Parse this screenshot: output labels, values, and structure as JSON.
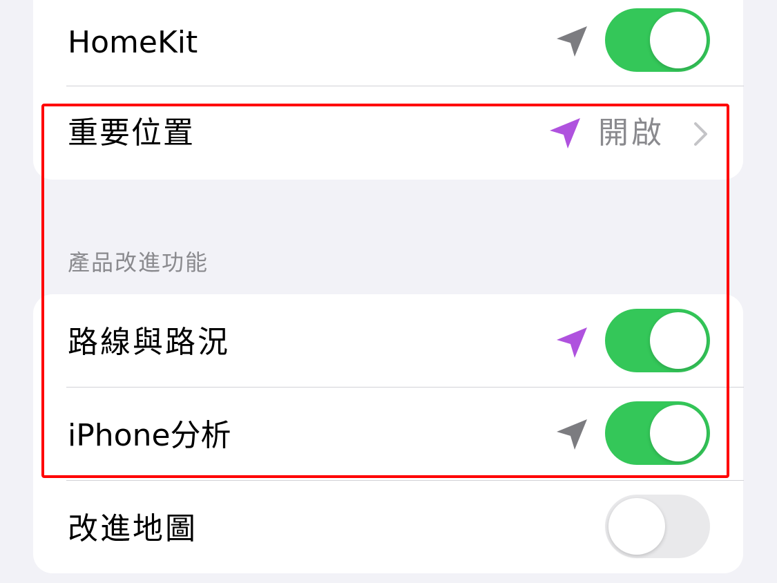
{
  "colors": {
    "toggle_on": "#34c759",
    "toggle_off": "#e9e9eb",
    "icon_gray": "#7c7c80",
    "icon_purple": "#af52de",
    "highlight_border": "#ff0000",
    "background": "#f2f2f7"
  },
  "rows": [
    {
      "label": "HomeKit",
      "icon": "location-arrow-icon",
      "icon_color": "gray",
      "toggle": "on"
    },
    {
      "label": "重要位置",
      "icon": "location-arrow-icon",
      "icon_color": "purple",
      "value": "開啟",
      "accessory": "chevron-right-icon"
    }
  ],
  "section_header": "產品改進功能",
  "section_rows": [
    {
      "label": "路線與路況",
      "icon": "location-arrow-icon",
      "icon_color": "purple",
      "toggle": "on"
    },
    {
      "label": "iPhone分析",
      "icon": "location-arrow-icon",
      "icon_color": "gray",
      "toggle": "on"
    },
    {
      "label": "改進地圖",
      "toggle": "off"
    }
  ]
}
